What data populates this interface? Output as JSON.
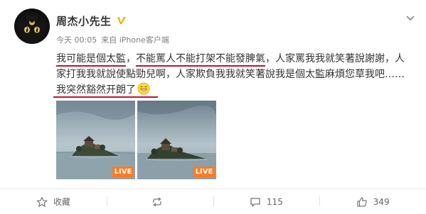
{
  "post": {
    "author_name": "周杰小先生",
    "time": "今天 00:05",
    "source": "来自 iPhone客户端",
    "text_line1_hl1": "我可能是個太監",
    "text_line1_sep": "，",
    "text_line1_hl2": "不能罵人不能打架不能發脾氣",
    "text_line1_rest": "，人家罵我我就笑著說謝謝，人",
    "text_line2": "家打我我就說使點勁兒啊，人家欺負我我就笑著說我是個太監麻煩您草我吧……",
    "text_line3_hl": "我突然豁然开朗了",
    "emoji": "grin-emoji",
    "photos": [
      {
        "badge": "LIVE"
      },
      {
        "badge": "LIVE"
      }
    ]
  },
  "actions": {
    "favorite_label": "收藏",
    "repost_count": "",
    "comment_count": "115",
    "like_count": "349"
  },
  "colors": {
    "underline": "#c4122e",
    "live_badge": "#ff7b24",
    "vip_badge": "#f7b100"
  },
  "icons": {
    "favorite": "star-icon",
    "repost": "repost-icon",
    "comment": "comment-icon",
    "like": "thumbs-up-icon",
    "more": "chevron-down-icon",
    "verified": "vip-badge-icon"
  }
}
